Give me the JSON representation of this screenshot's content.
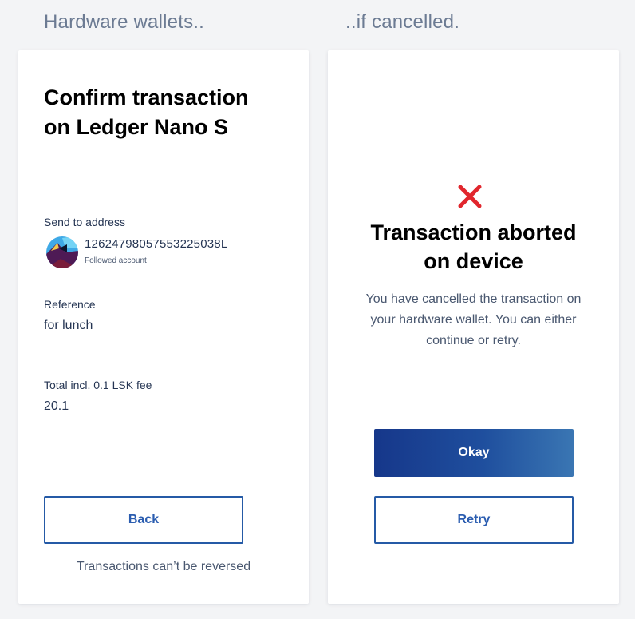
{
  "headings": {
    "left": "Hardware wallets..",
    "right": "..if cancelled."
  },
  "confirm_card": {
    "title_line1": "Confirm transaction",
    "title_line2": "on Ledger Nano S",
    "send_to_label": "Send to address",
    "address": "12624798057553225038L",
    "address_note": "Followed account",
    "reference_label": "Reference",
    "reference_value": "for lunch",
    "total_label": "Total incl. 0.1 LSK fee",
    "total_value": "20.1",
    "back_button": "Back",
    "footnote": "Transactions can’t be reversed"
  },
  "aborted_card": {
    "icon": "cross-icon",
    "title_line1": "Transaction aborted",
    "title_line2": "on device",
    "description_line1": "You have cancelled the transaction on",
    "description_line2": "your hardware wallet. You can either",
    "description_line3": "continue or retry.",
    "okay_button": "Okay",
    "retry_button": "Retry"
  },
  "colors": {
    "accent": "#255aa6",
    "error": "#e1262d",
    "background": "#f3f4f6"
  }
}
